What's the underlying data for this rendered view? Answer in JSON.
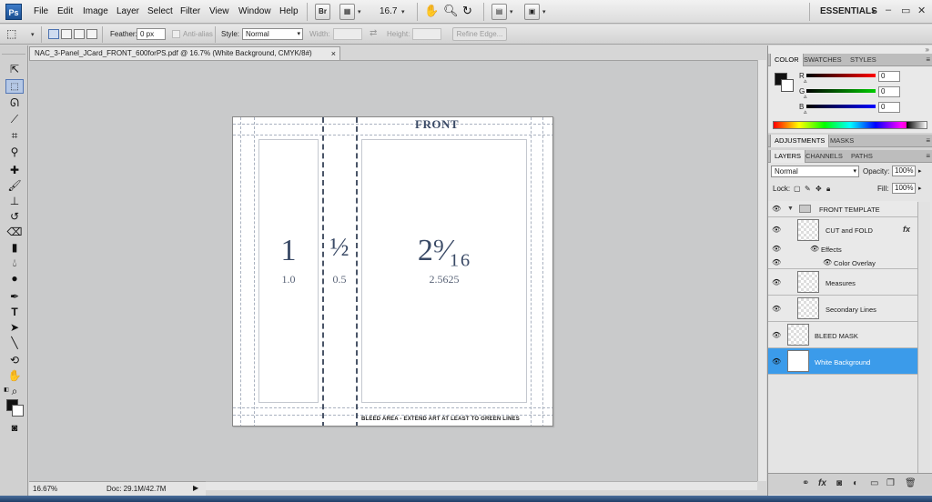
{
  "menubar": {
    "app_icon": "Ps",
    "items": [
      "File",
      "Edit",
      "Image",
      "Layer",
      "Select",
      "Filter",
      "View",
      "Window",
      "Help"
    ],
    "bridge_label": "Br",
    "zoom": "16.7",
    "workspace": "ESSENTIALS",
    "workspace_caret": "▾",
    "minimize": "–",
    "restore": "▭",
    "close": "✕"
  },
  "options": {
    "feather_label": "Feather:",
    "feather_value": "0 px",
    "antialias_label": "Anti-alias",
    "style_label": "Style:",
    "style_value": "Normal",
    "width_label": "Width:",
    "height_label": "Height:",
    "refine_label": "Refine Edge..."
  },
  "document": {
    "tab_title": "NAC_3-Panel_JCard_FRONT_600forPS.pdf @ 16.7% (White Background, CMYK/8#)",
    "tab_close": "×",
    "status_zoom": "16.67%",
    "status_doc": "Doc: 29.1M/42.7M",
    "status_arrow": "▶"
  },
  "artwork": {
    "title": "FRONT",
    "panel1_big": "1",
    "panel1_small": "1.0",
    "panel2_big": "½",
    "panel2_small": "0.5",
    "panel3_big": "2⁹⁄₁₆",
    "panel3_small": "2.5625",
    "bleed_note": "BLEED AREA - EXTEND ART AT LEAST TO GREEN LINES"
  },
  "color_panel": {
    "tabs": [
      "COLOR",
      "SWATCHES",
      "STYLES"
    ],
    "r_label": "R",
    "g_label": "G",
    "b_label": "B",
    "r_value": "0",
    "g_value": "0",
    "b_value": "0",
    "fg_color": "#111111",
    "bg_color": "#ffffff"
  },
  "adjustments_panel": {
    "tabs": [
      "ADJUSTMENTS",
      "MASKS"
    ]
  },
  "layers_panel": {
    "tabs": [
      "LAYERS",
      "CHANNELS",
      "PATHS"
    ],
    "blend_mode": "Normal",
    "opacity_label": "Opacity:",
    "opacity_value": "100%",
    "lock_label": "Lock:",
    "fill_label": "Fill:",
    "fill_value": "100%",
    "layers": [
      {
        "name": "FRONT TEMPLATE",
        "type": "group"
      },
      {
        "name": "CUT and FOLD",
        "type": "layer",
        "fx": "fx"
      },
      {
        "name": "Effects",
        "type": "effects"
      },
      {
        "name": "Color Overlay",
        "type": "effect"
      },
      {
        "name": "Measures",
        "type": "layer"
      },
      {
        "name": "Secondary Lines",
        "type": "layer"
      },
      {
        "name": "BLEED MASK",
        "type": "layer"
      },
      {
        "name": "White Background",
        "type": "layer",
        "selected": true
      }
    ],
    "bottom_icons": [
      "link-icon",
      "fx-icon",
      "mask-icon",
      "adjustment-icon",
      "new-group-icon",
      "new-layer-icon",
      "trash-icon"
    ]
  }
}
